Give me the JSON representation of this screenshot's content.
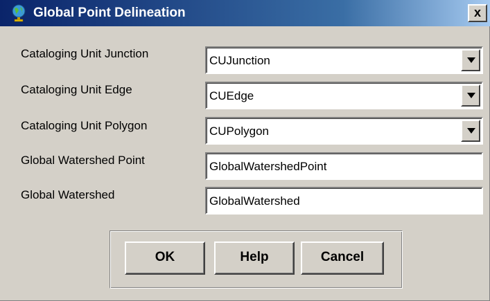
{
  "window": {
    "title": "Global Point Delineation",
    "icon": "globe-icon",
    "close_label": "x"
  },
  "fields": [
    {
      "label": "Cataloging Unit Junction",
      "value": "CUJunction",
      "type": "dropdown"
    },
    {
      "label": "Cataloging Unit Edge",
      "value": "CUEdge",
      "type": "dropdown"
    },
    {
      "label": "Cataloging Unit Polygon",
      "value": "CUPolygon",
      "type": "dropdown"
    },
    {
      "label": "Global Watershed Point",
      "value": "GlobalWatershedPoint",
      "type": "text"
    },
    {
      "label": "Global Watershed",
      "value": "GlobalWatershed",
      "type": "text"
    }
  ],
  "buttons": {
    "ok": "OK",
    "help": "Help",
    "cancel": "Cancel"
  }
}
